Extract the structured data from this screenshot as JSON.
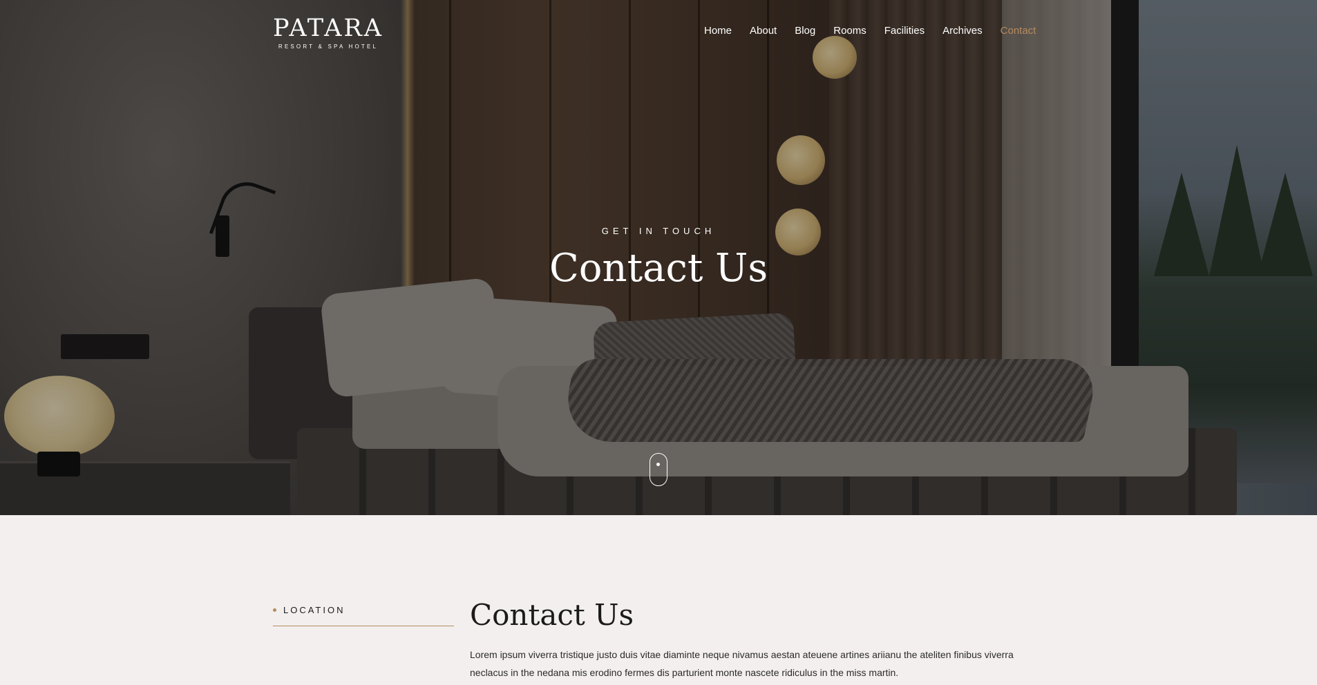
{
  "brand": {
    "title": "PATARA",
    "subtitle": "RESORT & SPA HOTEL"
  },
  "nav": {
    "items": [
      {
        "label": "Home"
      },
      {
        "label": "About"
      },
      {
        "label": "Blog"
      },
      {
        "label": "Rooms"
      },
      {
        "label": "Facilities"
      },
      {
        "label": "Archives"
      },
      {
        "label": "Contact"
      }
    ],
    "active": "Contact"
  },
  "hero": {
    "kicker": "GET IN TOUCH",
    "title": "Contact Us"
  },
  "content": {
    "side_label": "LOCATION",
    "title": "Contact Us",
    "text": "Lorem ipsum viverra tristique justo duis vitae diaminte neque nivamus aestan ateuene artines ariianu the ateliten finibus viverra neclacus in the nedana mis erodino fermes dis parturient monte nascete ridiculus in the miss martin."
  },
  "colors": {
    "accent": "#b58a5e",
    "background": "#f3efee"
  }
}
